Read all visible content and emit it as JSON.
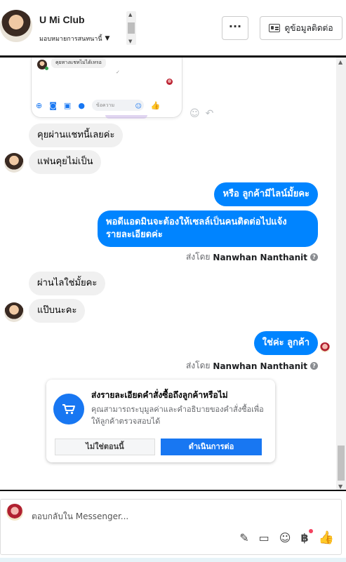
{
  "header": {
    "title": "U Mi Club",
    "assign_label": "มอบหมายการสนทนานี้",
    "more_label": "···",
    "contact_label": "ดูข้อมูลติดต่อ"
  },
  "preview": {
    "bubble_text": "คุยทางแชทไม่ได้เหรอ",
    "input_placeholder": "ข้อความ"
  },
  "messages": [
    {
      "direction": "in",
      "text": "คุยผ่านแชทนี้เลยค่ะ"
    },
    {
      "direction": "in",
      "text": "แฟนคุยไม่เป็น"
    },
    {
      "direction": "out",
      "text": "หรือ ลูกค้ามีไลน์มั้ยคะ"
    },
    {
      "direction": "out",
      "text_line1": "พอดีแอดมินจะต้องให้เซลล์เป็นคนติดต่อไปแจ้ง",
      "text_line2": "รายละเอียดค่ะ"
    },
    {
      "direction": "in",
      "text": "ผ่านไลใช่มั้ยคะ"
    },
    {
      "direction": "in",
      "text": "แป๊บนะคะ"
    },
    {
      "direction": "out",
      "text": "ใช่ค่ะ ลูกค้า"
    }
  ],
  "sent_by": {
    "prefix": "ส่งโดย",
    "name": "Nanwhan Nanthanit",
    "info_icon": "?"
  },
  "order_card": {
    "title": "ส่งรายละเอียดคำสั่งซื้อถึงลูกค้าหรือไม่",
    "description": "คุณสามารถระบุมูลค่าและคำอธิบายของคำสั่งซื้อเพื่อให้ลูกค้าตรวจสอบได้",
    "not_now": "ไม่ใช่ตอนนี้",
    "continue": "ดำเนินการต่อ"
  },
  "composer": {
    "placeholder": "ตอบกลับใน Messenger...",
    "tools": [
      "paperclip-icon",
      "saved-reply-icon",
      "emoji-icon",
      "baht-icon",
      "thumbs-up-icon"
    ],
    "baht_symbol": "฿"
  },
  "colors": {
    "accent": "#1877f2",
    "outgoing_bubble": "#0084ff",
    "incoming_bubble": "#f0f0f0"
  }
}
